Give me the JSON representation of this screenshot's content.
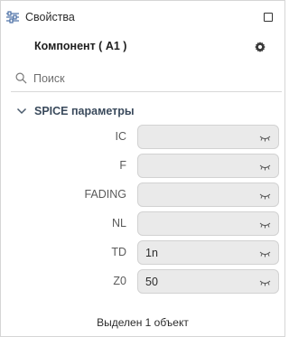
{
  "panel": {
    "title": "Свойства",
    "component_title": "Компонент ( A1 )"
  },
  "search": {
    "placeholder": "Поиск"
  },
  "section": {
    "title": "SPICE параметры",
    "expanded": true
  },
  "properties": [
    {
      "label": "IC",
      "value": ""
    },
    {
      "label": "F",
      "value": ""
    },
    {
      "label": "FADING",
      "value": ""
    },
    {
      "label": "NL",
      "value": ""
    },
    {
      "label": "TD",
      "value": "1n"
    },
    {
      "label": "Z0",
      "value": "50"
    }
  ],
  "status": {
    "text": "Выделен 1 объект"
  },
  "icons": {
    "title": "sliders-icon",
    "maximize": "maximize-icon",
    "settings": "gear-icon",
    "search": "search-icon",
    "section": "chevron-down-icon",
    "field": "eye-closed-icon"
  }
}
